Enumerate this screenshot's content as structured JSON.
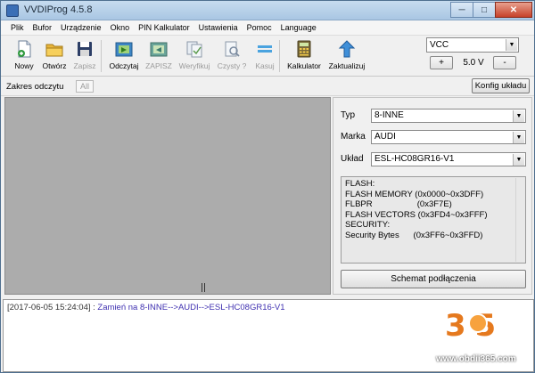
{
  "window": {
    "title": "VVDIProg 4.5.8",
    "minimize": "─",
    "maximize": "□",
    "close": "✕"
  },
  "menu": [
    "Plik",
    "Bufor",
    "Urządzenie",
    "Okno",
    "PIN Kalkulator",
    "Ustawienia",
    "Pomoc",
    "Language"
  ],
  "toolbar": {
    "buttons": [
      {
        "label": "Nowy",
        "icon": "new-file-icon",
        "enabled": true
      },
      {
        "label": "Otwórz",
        "icon": "open-folder-icon",
        "enabled": true
      },
      {
        "label": "Zapisz",
        "icon": "save-floppy-icon",
        "enabled": false
      },
      {
        "label": "Odczytaj",
        "icon": "read-chip-icon",
        "enabled": true
      },
      {
        "label": "ZAPISZ",
        "icon": "write-chip-icon",
        "enabled": false
      },
      {
        "label": "Weryfikuj",
        "icon": "verify-icon",
        "enabled": false
      },
      {
        "label": "Czysty ?",
        "icon": "blank-check-icon",
        "enabled": false
      },
      {
        "label": "Kasuj",
        "icon": "erase-icon",
        "enabled": false
      },
      {
        "label": "Kalkulator",
        "icon": "calculator-icon",
        "enabled": true
      },
      {
        "label": "Zaktualizuj",
        "icon": "update-arrow-icon",
        "enabled": true
      }
    ],
    "vcc": {
      "selected": "VCC",
      "plus": "+",
      "voltage": "5.0 V",
      "minus": "-"
    }
  },
  "read_bar": {
    "label": "Zakres odczytu",
    "value": "All",
    "konfig_button": "Konfig układu"
  },
  "right_panel": {
    "typ": {
      "label": "Typ",
      "value": "8-INNE"
    },
    "marka": {
      "label": "Marka",
      "value": "AUDI"
    },
    "uklad": {
      "label": "Układ",
      "value": "ESL-HC08GR16-V1"
    },
    "info_lines": [
      "FLASH:",
      "FLASH MEMORY (0x0000~0x3DFF)",
      "FLBPR                   (0x3F7E)",
      "FLASH VECTORS (0x3FD4~0x3FFF)",
      "SECURITY:",
      "Security Bytes      (0x3FF6~0x3FFD)"
    ],
    "schemat_button": "Schemat podłączenia"
  },
  "log": {
    "timestamp": "[2017-06-05 15:24:04]",
    "separator": " : ",
    "message": "Zamień na 8-INNE-->AUDI-->ESL-HC08GR16-V1"
  },
  "watermark": {
    "number": "3 5",
    "url": "www.obdii365.com"
  },
  "colors": {
    "gray_area": "#acacac",
    "log_message": "#3e2fb0",
    "watermark_orange": "#e5791e"
  }
}
